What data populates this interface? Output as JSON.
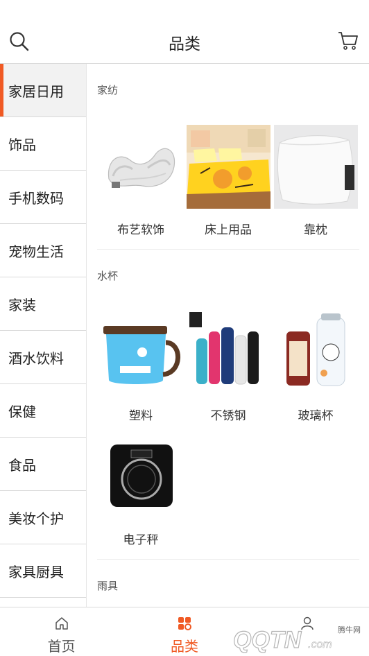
{
  "header": {
    "title": "品类",
    "search_icon": "search-icon",
    "cart_icon": "cart-icon"
  },
  "sidebar": {
    "items": [
      {
        "label": "家居日用",
        "active": true
      },
      {
        "label": "饰品"
      },
      {
        "label": "手机数码"
      },
      {
        "label": "宠物生活"
      },
      {
        "label": "家装"
      },
      {
        "label": "酒水饮料"
      },
      {
        "label": "保健"
      },
      {
        "label": "食品"
      },
      {
        "label": "美妆个护"
      },
      {
        "label": "家具厨具"
      }
    ]
  },
  "sections": [
    {
      "title": "家纺",
      "items": [
        {
          "label": "布艺软饰",
          "image": "neck-pillow-image"
        },
        {
          "label": "床上用品",
          "image": "bedding-image"
        },
        {
          "label": "靠枕",
          "image": "cushion-image"
        }
      ]
    },
    {
      "title": "水杯",
      "items": [
        {
          "label": "塑料",
          "image": "mug-image"
        },
        {
          "label": "不锈钢",
          "image": "steel-bottles-image"
        },
        {
          "label": "玻璃杯",
          "image": "glass-bottle-image"
        },
        {
          "label": "电子秤",
          "image": "scale-image"
        }
      ]
    },
    {
      "title": "雨具",
      "items": []
    }
  ],
  "tabbar": {
    "tabs": [
      {
        "label": "首页",
        "icon": "home-icon"
      },
      {
        "label": "品类",
        "icon": "category-icon",
        "active": true
      },
      {
        "label": "",
        "icon": "user-icon"
      }
    ]
  },
  "watermark": {
    "text": "腾牛网",
    "logo": "qqtn.com"
  },
  "colors": {
    "accent": "#f05a24",
    "divider": "#d9d9d9",
    "active_bg": "#f2f2f2"
  }
}
